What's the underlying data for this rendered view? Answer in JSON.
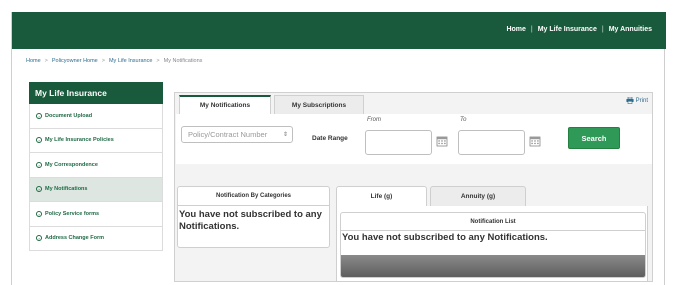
{
  "header": {
    "nav": [
      "Home",
      "My Life Insurance",
      "My Annuities"
    ]
  },
  "breadcrumb": [
    "Home",
    "Policyowner Home",
    "My Life Insurance",
    "My Notifications"
  ],
  "sidebar": {
    "title": "My Life Insurance",
    "items": [
      {
        "label": "Document Upload",
        "active": false
      },
      {
        "label": "My Life Insurance Policies",
        "active": false
      },
      {
        "label": "My Correspondence",
        "active": false
      },
      {
        "label": "My Notifications",
        "active": true
      },
      {
        "label": "Policy Service forms",
        "active": false
      },
      {
        "label": "Address Change Form",
        "active": false
      }
    ]
  },
  "main": {
    "tabs": [
      "My Notifications",
      "My Subscriptions"
    ],
    "print_label": "Print",
    "filters": {
      "policy_placeholder": "Policy/Contract Number",
      "date_range_label": "Date Range",
      "from_label": "From",
      "to_label": "To",
      "search_label": "Search"
    },
    "categories": {
      "title": "Notification By Categories",
      "message": "You have not subscribed to any Notifications."
    },
    "sub_tabs": [
      "Life (g)",
      "Annuity (g)"
    ],
    "list": {
      "title": "Notification List",
      "message": "You have not subscribed to any Notifications."
    }
  },
  "colors": {
    "brand": "#1a5a3c",
    "button": "#2f9a57",
    "link": "#2f6d8f"
  }
}
